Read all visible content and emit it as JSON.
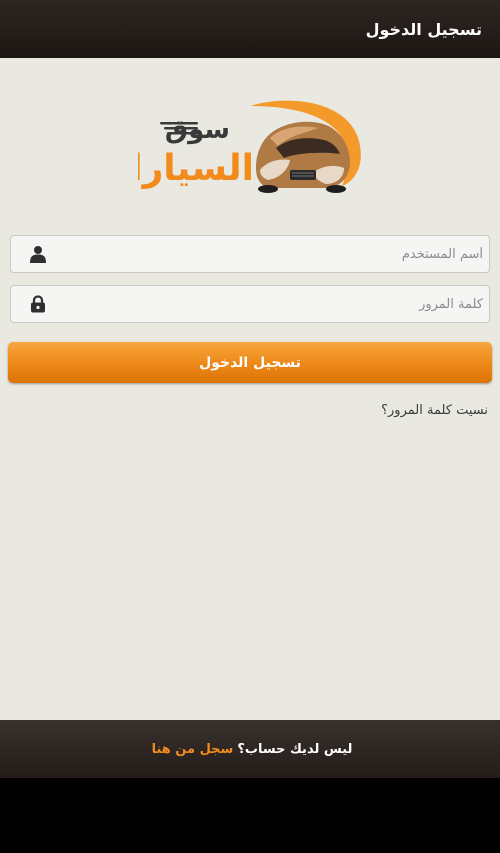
{
  "app_bar": {
    "title": "تسجيل الدخول"
  },
  "logo": {
    "line1": "سوق",
    "line2": "السيارات",
    "primary_color": "#f28b1c",
    "secondary_color": "#3a3a3a"
  },
  "form": {
    "username": {
      "value": "",
      "placeholder": "أسم المستخدم",
      "icon": "user-icon"
    },
    "password": {
      "value": "",
      "placeholder": "كلمة المرور",
      "icon": "lock-icon"
    },
    "login_button_label": "تسجيل الدخول",
    "forgot_password_label": "نسيت كلمة المرور؟"
  },
  "footer": {
    "prompt": "ليس لديك حساب؟",
    "register_link": "سجل من هنا"
  },
  "colors": {
    "accent": "#f28b1c",
    "bar_dark": "#231c19",
    "content_bg": "#e9e8e1"
  }
}
